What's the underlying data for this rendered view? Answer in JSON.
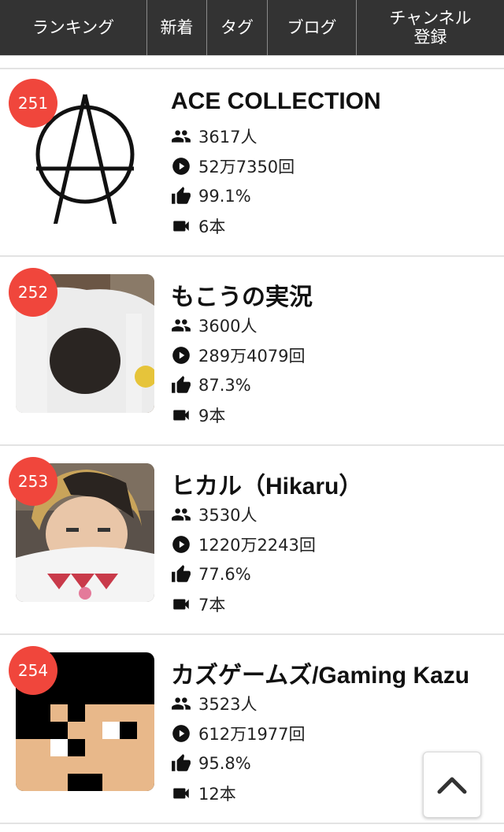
{
  "nav": {
    "items": [
      {
        "label": "ランキング"
      },
      {
        "label": "新着"
      },
      {
        "label": "タグ"
      },
      {
        "label": "ブログ"
      },
      {
        "label_line1": "チャンネル",
        "label_line2": "登録"
      }
    ]
  },
  "channels": [
    {
      "rank": "251",
      "name": "ACE COLLECTION",
      "subscribers": "3617人",
      "views": "52万7350回",
      "rating": "99.1%",
      "videos": "6本"
    },
    {
      "rank": "252",
      "name": "もこうの実況",
      "subscribers": "3600人",
      "views": "289万4079回",
      "rating": "87.3%",
      "videos": "9本"
    },
    {
      "rank": "253",
      "name": "ヒカル（Hikaru）",
      "subscribers": "3530人",
      "views": "1220万2243回",
      "rating": "77.6%",
      "videos": "7本"
    },
    {
      "rank": "254",
      "name": "カズゲームズ/Gaming Kazu",
      "subscribers": "3523人",
      "views": "612万1977回",
      "rating": "95.8%",
      "videos": "12本"
    }
  ],
  "icons": {
    "subscribers": "people-icon",
    "views": "play-circle-icon",
    "rating": "thumbs-up-icon",
    "videos": "videocam-icon",
    "scroll_top": "chevron-up-icon"
  },
  "colors": {
    "nav_bg": "#333333",
    "rank_badge": "#f0463c"
  }
}
